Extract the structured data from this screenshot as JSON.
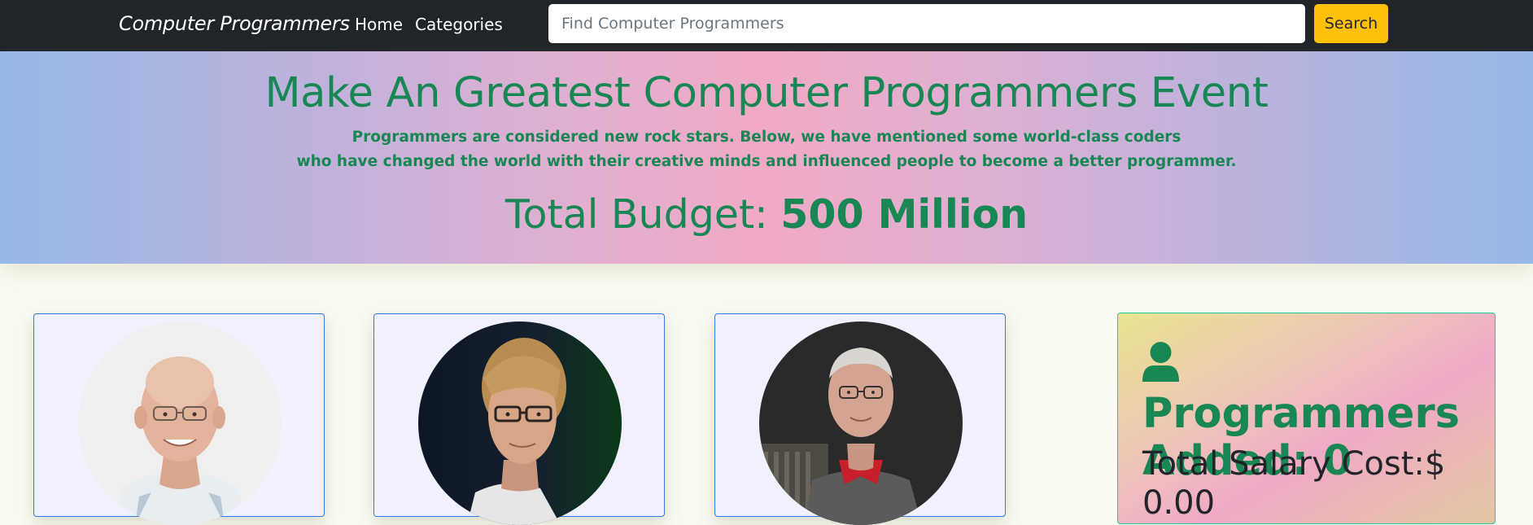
{
  "navbar": {
    "brand": "Computer Programmers",
    "links": [
      "Home",
      "Categories"
    ],
    "search": {
      "placeholder": "Find Computer Programmers",
      "value": "",
      "button_label": "Search"
    }
  },
  "hero": {
    "title": "Make An Greatest Computer Programmers Event",
    "description_line1": "Programmers are considered new rock stars. Below, we have mentioned some world-class coders",
    "description_line2": "who have changed the world with their creative minds and influenced people to become a better programmer.",
    "budget_label": "Total Budget: ",
    "budget_value": "500 Million"
  },
  "cards": [
    {
      "photo": "programmer-photo-1"
    },
    {
      "photo": "programmer-photo-2"
    },
    {
      "photo": "programmer-photo-3"
    }
  ],
  "summary": {
    "icon": "user-icon",
    "heading": "Programmers Added: 0",
    "salary_label": "Total Salary Cost:$",
    "salary_value": "0.00"
  },
  "colors": {
    "navbar_bg": "#212529",
    "accent_green": "#198754",
    "search_button": "#ffc107",
    "card_border": "#2b7de0",
    "card_bg": "#f1f0fe",
    "panel_border": "#20c997"
  }
}
